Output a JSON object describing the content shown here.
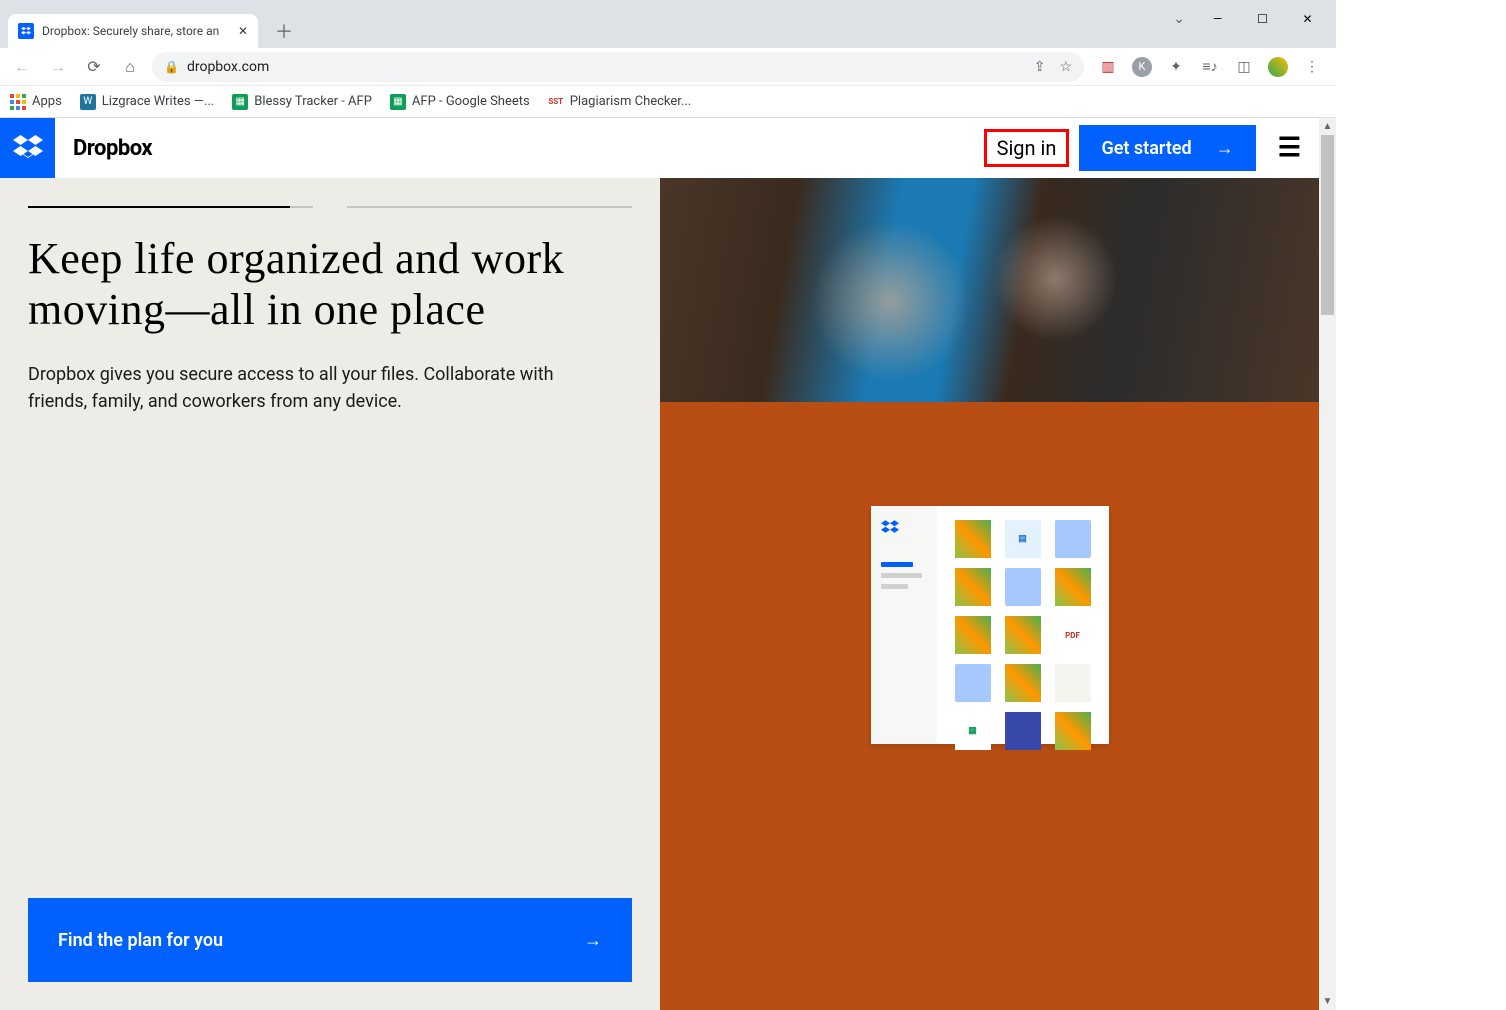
{
  "browser": {
    "tab_title": "Dropbox: Securely share, store an",
    "url": "dropbox.com",
    "bookmarks": [
      {
        "label": "Apps",
        "color": "apps"
      },
      {
        "label": "Lizgrace Writes —...",
        "color": "#21759b"
      },
      {
        "label": "Blessy Tracker - AFP",
        "color": "#0f9d58"
      },
      {
        "label": "AFP - Google Sheets",
        "color": "#0f9d58"
      },
      {
        "label": "Plagiarism Checker...",
        "color": "#d93025"
      }
    ]
  },
  "site": {
    "brand": "Dropbox",
    "signin_label": "Sign in",
    "get_started_label": "Get started",
    "headline": "Keep life organized and work moving—all in one place",
    "subtext": "Dropbox gives you secure access to all your files. Collaborate with friends, family, and coworkers from any device.",
    "cta_label": "Find the plan for you",
    "preview_pdf_label": "PDF"
  },
  "colors": {
    "accent": "#0061fe",
    "hero_bg": "#b84e14",
    "highlight_border": "#ff0000"
  }
}
